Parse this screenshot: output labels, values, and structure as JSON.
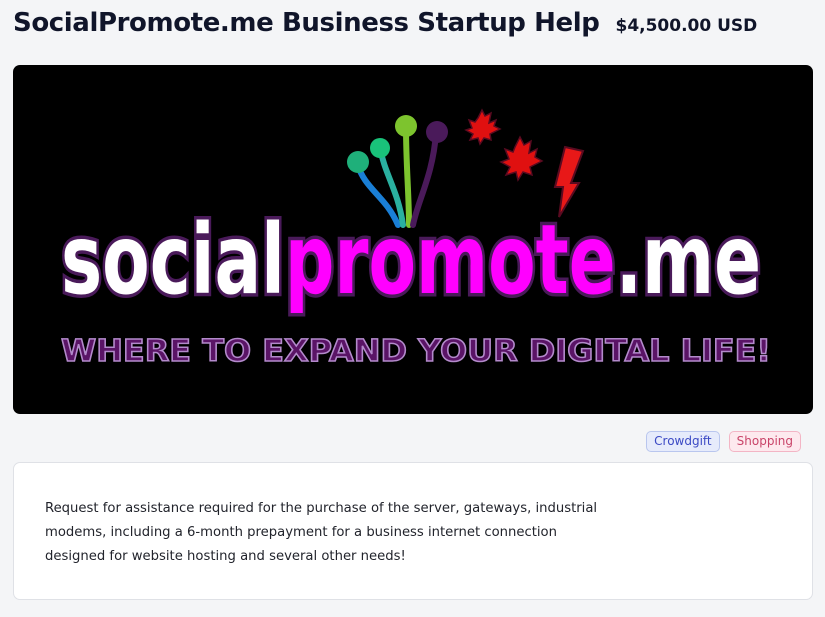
{
  "header": {
    "title": "SocialPromote.me Business Startup Help",
    "price": "$4,500.00 USD"
  },
  "banner": {
    "logo_part1": "social",
    "logo_part2": "promote",
    "logo_part3": ".me",
    "tagline": "WHERE TO EXPAND YOUR DIGITAL LIFE!",
    "colors": {
      "background": "#000000",
      "white_text": "#ffffff",
      "magenta_text": "#ff00ff",
      "outline": "#4a1a5a",
      "tagline": "#5a1466",
      "maple_leaf": "#e01010"
    }
  },
  "tags": [
    {
      "label": "Crowdgift"
    },
    {
      "label": "Shopping"
    }
  ],
  "description": "Request for assistance required for the purchase of the server, gateways, industrial modems, including a 6-month prepayment for a business internet connection designed for website hosting and several other needs!"
}
